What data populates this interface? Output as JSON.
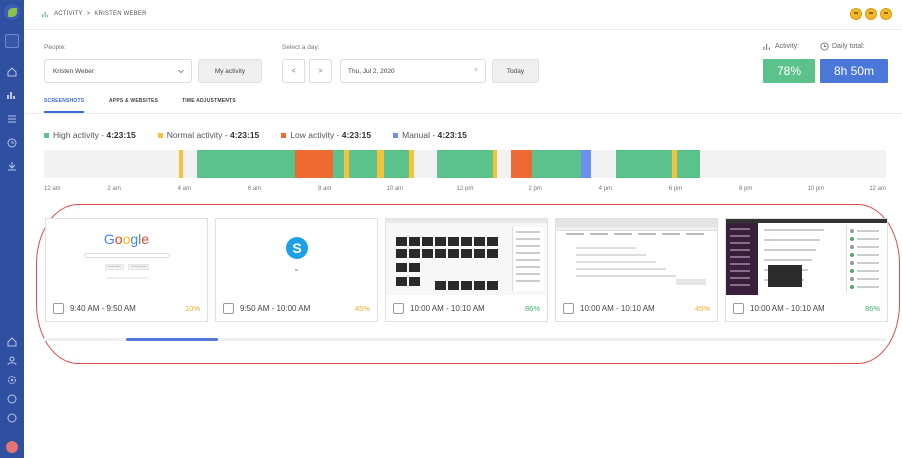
{
  "header": {
    "breadcrumb_section": "ACTIVITY",
    "breadcrumb_sep": ">",
    "breadcrumb_user": "KRISTEN WEBER"
  },
  "filters": {
    "people_label": "People:",
    "people_value": "Kristen Weber",
    "my_activity_label": "My activity",
    "day_label": "Select a day:",
    "prev_label": "<",
    "next_label": ">",
    "date_value": "Thu, Jul 2, 2020",
    "clear_label": "×",
    "today_label": "Today"
  },
  "stats": {
    "activity_label": "Activity:",
    "activity_value": "78%",
    "daily_total_label": "Daily total:",
    "daily_total_value": "8h 50m",
    "activity_color": "#5cc28b",
    "total_color": "#4b78d8"
  },
  "tabs": [
    {
      "label": "SCREENSHOTS",
      "active": true
    },
    {
      "label": "APPS & WEBSITES",
      "active": false
    },
    {
      "label": "TIME ADJUSTMENTS",
      "active": false
    }
  ],
  "legend": [
    {
      "label": "High activity - ",
      "value": "4:23:15",
      "color": "#5cc28b"
    },
    {
      "label": "Normal activity - ",
      "value": "4:23:15",
      "color": "#f5c23c"
    },
    {
      "label": "Low activity - ",
      "value": "4:23:15",
      "color": "#ee6a32"
    },
    {
      "label": "Manual - ",
      "value": "4:23:15",
      "color": "#6d8ff0"
    }
  ],
  "timeline": {
    "range_hours": [
      0,
      24
    ],
    "segments": [
      {
        "start": 3.85,
        "end": 3.95,
        "level": "normal"
      },
      {
        "start": 4.35,
        "end": 7.15,
        "level": "high"
      },
      {
        "start": 7.15,
        "end": 8.25,
        "level": "low"
      },
      {
        "start": 8.25,
        "end": 8.55,
        "level": "high"
      },
      {
        "start": 8.55,
        "end": 8.7,
        "level": "normal"
      },
      {
        "start": 8.7,
        "end": 9.5,
        "level": "high"
      },
      {
        "start": 9.5,
        "end": 9.7,
        "level": "normal"
      },
      {
        "start": 9.7,
        "end": 10.4,
        "level": "high"
      },
      {
        "start": 10.4,
        "end": 10.55,
        "level": "normal"
      },
      {
        "start": 11.2,
        "end": 12.8,
        "level": "high"
      },
      {
        "start": 12.8,
        "end": 12.9,
        "level": "normal"
      },
      {
        "start": 13.3,
        "end": 13.9,
        "level": "low"
      },
      {
        "start": 13.9,
        "end": 15.3,
        "level": "high"
      },
      {
        "start": 15.3,
        "end": 15.6,
        "level": "manual"
      },
      {
        "start": 16.3,
        "end": 17.9,
        "level": "high"
      },
      {
        "start": 17.9,
        "end": 18.05,
        "level": "normal"
      },
      {
        "start": 18.05,
        "end": 18.7,
        "level": "high"
      }
    ],
    "ticks": [
      "12 am",
      "2 am",
      "4 am",
      "6 am",
      "8 am",
      "10 am",
      "12 pm",
      "2 pm",
      "4 pm",
      "6 pm",
      "8 pm",
      "10 pm",
      "12 am"
    ]
  },
  "screenshots": [
    {
      "time": "9:40 AM - 9:50 AM",
      "pct": "10%",
      "pct_color": "#f0a92b",
      "thumb": "google"
    },
    {
      "time": "9:50 AM - 10:00 AM",
      "pct": "45%",
      "pct_color": "#f0a92b",
      "thumb": "skype"
    },
    {
      "time": "10:00 AM - 10:10 AM",
      "pct": "86%",
      "pct_color": "#3fb071",
      "thumb": "dashboard"
    },
    {
      "time": "10:00 AM - 10:10 AM",
      "pct": "45%",
      "pct_color": "#f0a92b",
      "thumb": "browser"
    },
    {
      "time": "10:00 AM - 10:10 AM",
      "pct": "86%",
      "pct_color": "#3fb071",
      "thumb": "slack"
    }
  ],
  "thumbs": {
    "google_logo": "Google",
    "google_btn1": "Google Search",
    "google_btn2": "I'm Feeling Lucky"
  },
  "icons": {
    "sidebar": [
      "home-icon",
      "activity-icon",
      "list-icon",
      "clock-icon",
      "download-icon",
      "house-icon",
      "people-icon",
      "settings-icon",
      "help-icon",
      "info-icon"
    ]
  }
}
